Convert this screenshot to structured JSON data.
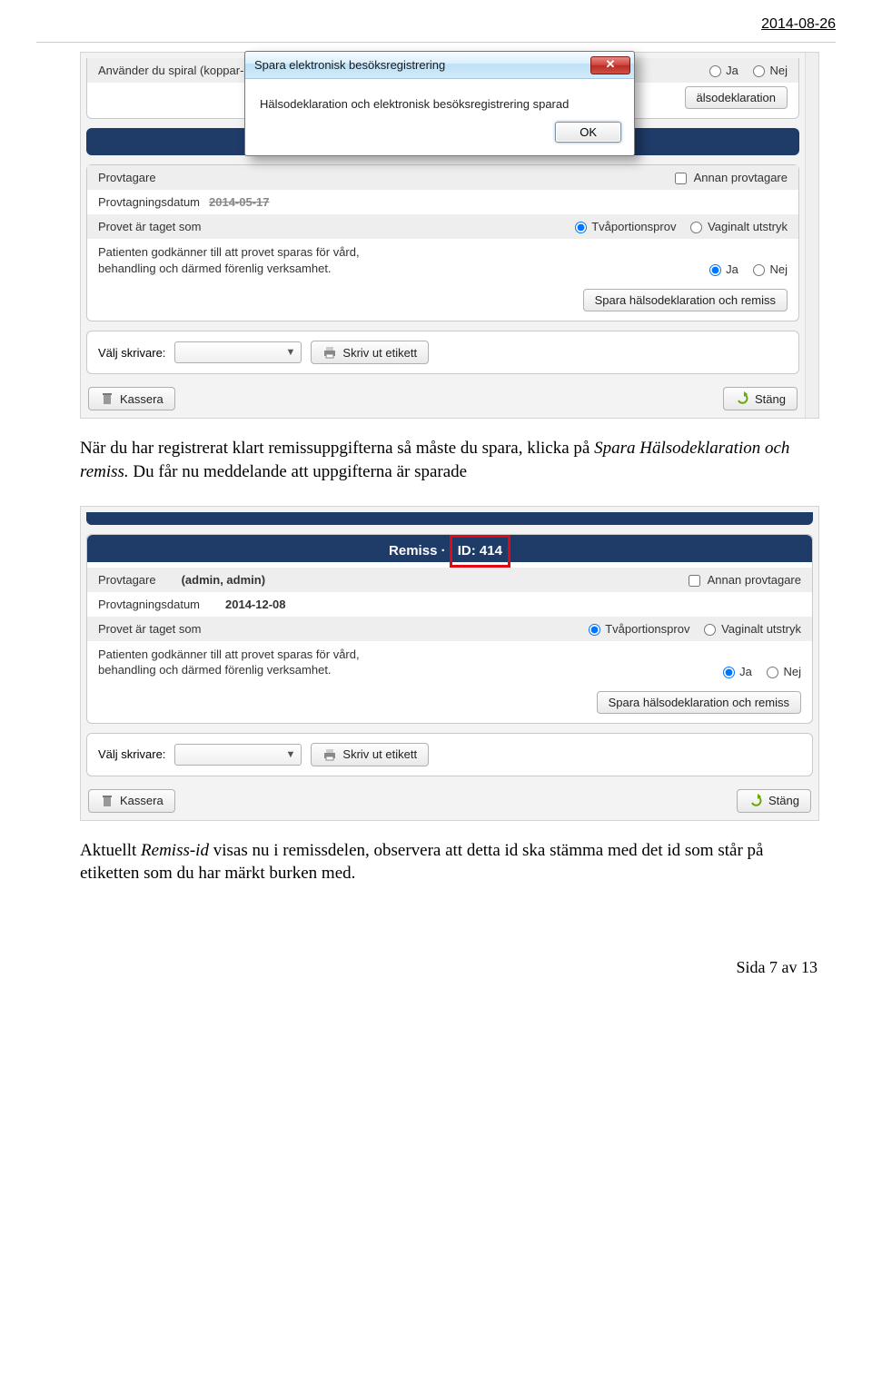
{
  "page": {
    "date": "2014-08-26",
    "footer": "Sida 7 av 13"
  },
  "text": {
    "para1_a": "När du har registrerat klart remissuppgifterna så måste du spara, klicka på ",
    "para1_b": "Spara Hälsodeklaration och remiss.",
    "para1_c": " Du får nu meddelande att uppgifterna är sparade",
    "para2_a": "Aktuellt ",
    "para2_b": "Remiss-id",
    "para2_c": " visas nu i remissdelen, observera att detta id ska stämma med det id som står på etiketten som du har märkt burken med."
  },
  "dialog": {
    "title": "Spara elektronisk besöksregistrering",
    "message": "Hälsodeklaration och elektronisk besöksregistrering sparad",
    "ok": "OK"
  },
  "shot1": {
    "q_spiral": "Använder du spiral (koppar-, hormonspiral)?",
    "ja": "Ja",
    "nej": "Nej",
    "halso_btn_fragment": "älsodeklaration",
    "provtagare": "Provtagare",
    "annan": "Annan provtagare",
    "provdatum_label": "Provtagningsdatum",
    "provdatum_val": "2014-05-17",
    "taget": "Provet är taget som",
    "tva": "Tvåportionsprov",
    "vag": "Vaginalt utstryk",
    "consent": "Patienten godkänner till att provet sparas för vård, behandling och därmed förenlig verksamhet.",
    "spara_btn": "Spara hälsodeklaration och remiss",
    "valj": "Välj skrivare:",
    "print": "Skriv ut etikett",
    "kassera": "Kassera",
    "stang": "Stäng"
  },
  "shot2": {
    "header_a": "Remiss · ",
    "header_b": "ID: 414",
    "provtagare": "Provtagare",
    "provtagare_val": "(admin, admin)",
    "annan": "Annan provtagare",
    "provdatum_label": "Provtagningsdatum",
    "provdatum_val": "2014-12-08",
    "taget": "Provet är taget som",
    "tva": "Tvåportionsprov",
    "vag": "Vaginalt utstryk",
    "consent": "Patienten godkänner till att provet sparas för vård, behandling och därmed förenlig verksamhet.",
    "ja": "Ja",
    "nej": "Nej",
    "spara_btn": "Spara hälsodeklaration och remiss",
    "valj": "Välj skrivare:",
    "print": "Skriv ut etikett",
    "kassera": "Kassera",
    "stang": "Stäng"
  }
}
